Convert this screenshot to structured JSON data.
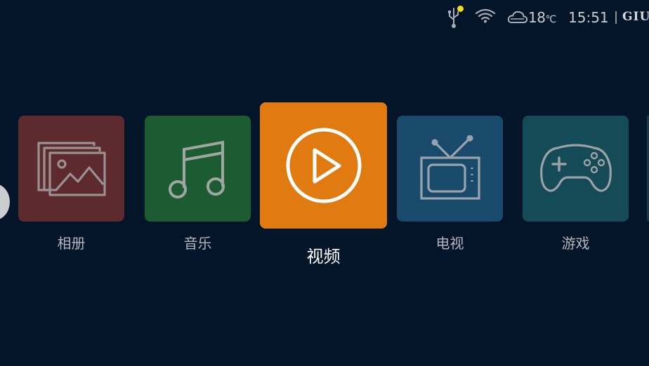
{
  "status_bar": {
    "icons": [
      "usb-icon",
      "wifi-icon",
      "cloud-icon"
    ],
    "temperature": "18",
    "temperature_unit": "℃",
    "time": "15:51",
    "brand": "GIU"
  },
  "menu": {
    "items": [
      {
        "label": "相册",
        "icon": "photo-icon",
        "color": "#5d2a2d"
      },
      {
        "label": "音乐",
        "icon": "music-note-icon",
        "color": "#1d5b33"
      },
      {
        "label": "视频",
        "icon": "play-icon",
        "color": "#e27a12",
        "selected": true
      },
      {
        "label": "电视",
        "icon": "tv-icon",
        "color": "#1a4a6b"
      },
      {
        "label": "游戏",
        "icon": "gamepad-icon",
        "color": "#154a57"
      }
    ]
  },
  "colors": {
    "background": "#04152a",
    "usb_indicator": "#f2dd1f"
  }
}
